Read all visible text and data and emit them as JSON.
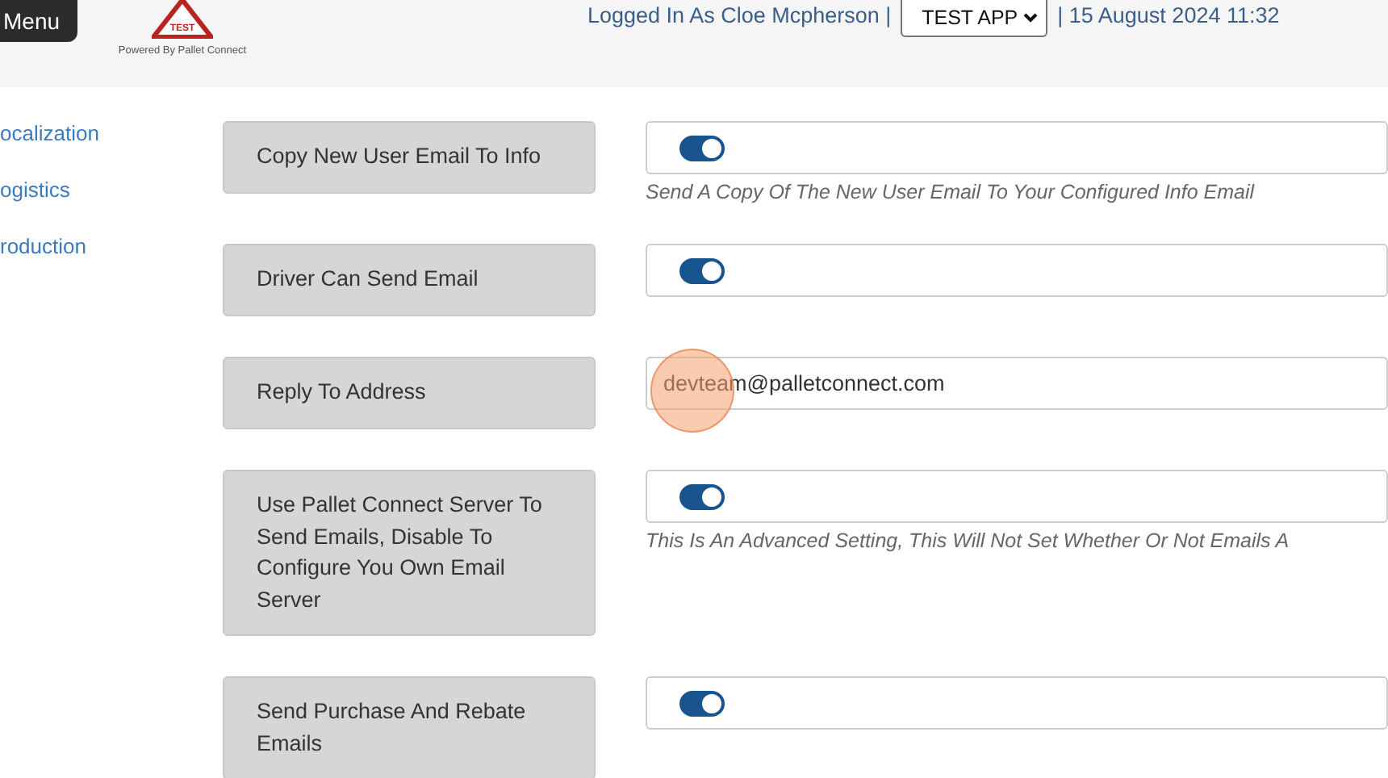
{
  "header": {
    "menu_button": "Menu",
    "logo_badge": "TEST",
    "logo_caption": "Powered By Pallet Connect",
    "logged_in": "Logged In As Cloe Mcpherson |",
    "app_select": "TEST APP",
    "datetime": "| 15 August 2024 11:32"
  },
  "sidebar": {
    "items": [
      {
        "label": "ocalization"
      },
      {
        "label": "ogistics"
      },
      {
        "label": "roduction"
      }
    ]
  },
  "settings": [
    {
      "kind": "toggle",
      "label": "Copy New User Email To Info",
      "on": true,
      "hint": "Send A Copy Of The New User Email To Your Configured Info Email"
    },
    {
      "kind": "toggle",
      "label": "Driver Can Send Email",
      "on": true
    },
    {
      "kind": "text",
      "label": "Reply To Address",
      "value": "devteam@palletconnect.com"
    },
    {
      "kind": "toggle",
      "label": "Use Pallet Connect Server To Send Emails, Disable To Configure You Own Email Server",
      "on": true,
      "hint": "This Is An Advanced Setting, This Will Not Set Whether Or Not Emails A"
    },
    {
      "kind": "toggle",
      "label": "Send Purchase And Rebate Emails",
      "on": true
    }
  ]
}
